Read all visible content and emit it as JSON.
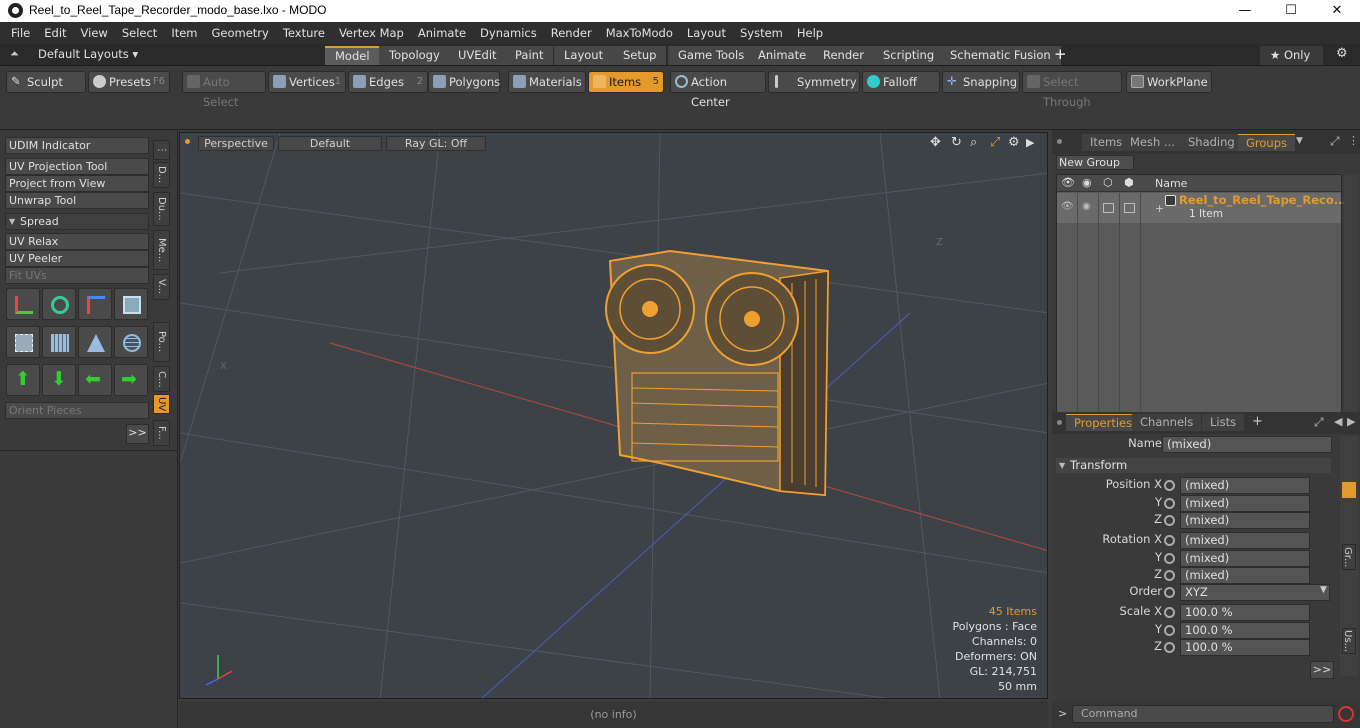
{
  "window": {
    "title": "Reel_to_Reel_Tape_Recorder_modo_base.lxo - MODO",
    "minimize": "—",
    "maximize": "☐",
    "close": "✕"
  },
  "menu": [
    "File",
    "Edit",
    "View",
    "Select",
    "Item",
    "Geometry",
    "Texture",
    "Vertex Map",
    "Animate",
    "Dynamics",
    "Render",
    "MaxToModo",
    "Layout",
    "System",
    "Help"
  ],
  "layouts_label": "Default Layouts ▾",
  "tabs": [
    "Model",
    "Topology",
    "UVEdit",
    "Paint",
    "Layout",
    "Setup",
    "Game Tools",
    "Animate",
    "Render",
    "Scripting",
    "Schematic Fusion"
  ],
  "tab_add": "+",
  "only_label": "★  Only",
  "toolbar": {
    "sculpt": "Sculpt",
    "presets": "Presets",
    "presets_key": "F6",
    "auto_select": "Auto Select",
    "vertices": "Vertices",
    "vertices_key": "1",
    "edges": "Edges",
    "edges_key": "2",
    "polygons": "Polygons",
    "materials": "Materials",
    "items": "Items",
    "items_key": "5",
    "action_center": "Action Center",
    "symmetry": "Symmetry",
    "falloff": "Falloff",
    "snapping": "Snapping",
    "select_through": "Select Through",
    "workplane": "WorkPlane"
  },
  "left": {
    "udim": "UDIM Indicator",
    "uv_projection": "UV Projection Tool",
    "project_view": "Project from View",
    "unwrap": "Unwrap Tool",
    "spread": "Spread",
    "uv_relax": "UV Relax",
    "uv_peeler": "UV Peeler",
    "fit_uvs": "Fit UVs",
    "orient": "Orient Pieces",
    "more": ">>",
    "vtabs": [
      "D...",
      "Du...",
      "Me...",
      "V...",
      "Po...",
      "C...",
      "UV",
      "F..."
    ]
  },
  "viewport": {
    "perspective": "Perspective",
    "default": "Default",
    "raygl": "Ray GL: Off",
    "items_count": "45 Items",
    "polygons": "Polygons : Face",
    "channels": "Channels: 0",
    "deformers": "Deformers: ON",
    "gl": "GL: 214,751",
    "focal": "50 mm",
    "axis_x": "X",
    "axis_z": "Z"
  },
  "groups": {
    "tabs": [
      "Items",
      "Mesh ...",
      "Shading",
      "Groups"
    ],
    "new_group": "New Group",
    "col_name": "Name",
    "item_name": "Reel_to_Reel_Tape_Reco...",
    "item_count": "1 Item"
  },
  "properties": {
    "tabs": [
      "Properties",
      "Channels",
      "Lists"
    ],
    "add": "+",
    "name_label": "Name",
    "name_value": "(mixed)",
    "transform": "Transform",
    "rows": [
      {
        "label": "Position X",
        "value": "(mixed)"
      },
      {
        "label": "Y",
        "value": "(mixed)"
      },
      {
        "label": "Z",
        "value": "(mixed)"
      },
      {
        "label": "Rotation X",
        "value": "(mixed)"
      },
      {
        "label": "Y",
        "value": "(mixed)"
      },
      {
        "label": "Z",
        "value": "(mixed)"
      },
      {
        "label": "Order",
        "value": "XYZ"
      },
      {
        "label": "Scale X",
        "value": "100.0 %"
      },
      {
        "label": "Y",
        "value": "100.0 %"
      },
      {
        "label": "Z",
        "value": "100.0 %"
      }
    ],
    "side_tabs": [
      "Gr...",
      "Us..."
    ],
    "more": ">>"
  },
  "status": {
    "info": "(no info)",
    "command": "Command",
    "prompt": ">"
  },
  "colors": {
    "accent": "#e49a2a",
    "wire": "#f0a030",
    "grid": "#53575e"
  }
}
